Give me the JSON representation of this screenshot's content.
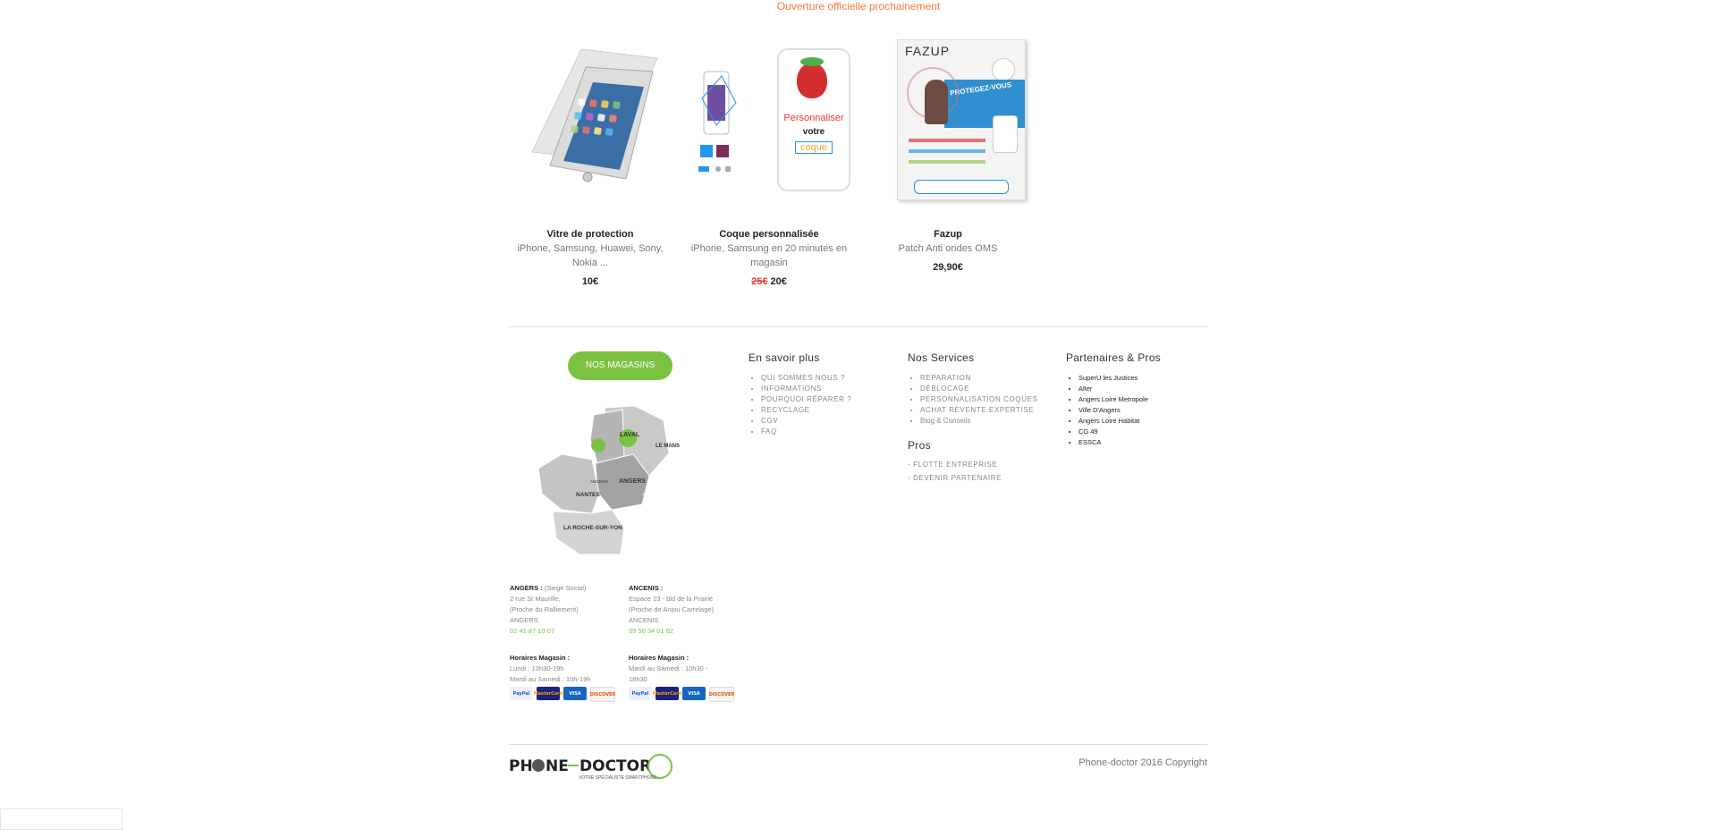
{
  "notice": "Ouverture officielle prochainement",
  "products": [
    {
      "name": "Vitre de protection",
      "desc": "iPhone, Samsung, Huawei, Sony, Nokia ...",
      "old_price": "",
      "price": "10€"
    },
    {
      "name": "Coque personnalisée",
      "desc": "iPhone, Samsung en 20 minutes en magasin",
      "old_price": "25€",
      "price": "20€",
      "image_text": {
        "line1": "Personnaliser",
        "line2": "votre",
        "line3": "coque"
      }
    },
    {
      "name": "Fazup",
      "desc": "Patch Anti ondes OMS",
      "old_price": "",
      "price": "29,90€",
      "image_text": {
        "brand": "FAZUP",
        "tagline": "PROTEGEZ-VOUS"
      }
    }
  ],
  "stores_button": "NOS MAGASINS",
  "map": {
    "laval": "LAVAL",
    "le_mans": "LE MANS",
    "ancenis": "ANCENIS",
    "angers": "ANGERS",
    "nantes": "NANTES",
    "la_roche": "LA ROCHE-SUR-YON",
    "saumur": "SAUMUR"
  },
  "stores": [
    {
      "city": "ANGERS :",
      "city_note": "(Siege Social)",
      "addr1": "2 rue St Maurille,",
      "addr2": "(Proche du Ralliement)",
      "addr3": "ANGERS",
      "phone": "02 41 87 10 07",
      "hours_title": "Horaires Magasin :",
      "hours1": "Lundi : 13h30-19h",
      "hours2": "Mardi au Samedi : 10h-19h"
    },
    {
      "city": "ANCENIS :",
      "city_note": "",
      "addr1": "Espace 23 - bld de la Prairie",
      "addr2": "(Proche de Anjou Carrelage)",
      "addr3": "ANCENIS",
      "phone": "09 50 34 01 62",
      "hours_title": "Horaires Magasin :",
      "hours1": "Mardi au Samedi : 10h30 -",
      "hours2": "18h30"
    }
  ],
  "cards": [
    "PayPal",
    "MasterCard",
    "VISA",
    "DISCOVER"
  ],
  "footer": {
    "col1": {
      "title": "En savoir plus",
      "items": [
        "QUI SOMMES NOUS ?",
        "INFORMATIONS",
        "POURQUOI RÉPARER ?",
        "RECYCLAGE",
        "CGV",
        "FAQ"
      ]
    },
    "col2": {
      "title": "Nos Services",
      "items": [
        "REPARATION",
        "DÉBLOCAGE",
        "PERSONNALISATION COQUES",
        "ACHAT REVENTE EXPERTISE",
        "Blog & Conseils"
      ]
    },
    "pros": {
      "title": "Pros",
      "items": [
        "- FLOTTE ENTREPRISE",
        "- DEVENIR PARTENAIRE"
      ]
    },
    "col3": {
      "title": "Partenaires & Pros",
      "items": [
        "SuperU les Justices",
        "Alter",
        "Angers Loire Metropole",
        "Ville D'Angers",
        "Angers Loire Habitat",
        "CG 49",
        "ESSCA"
      ]
    }
  },
  "logo": {
    "text_left": "PH",
    "text_right": "NE",
    "text_doctor": "DOCTOR",
    "tagline": "VOTRE SPÉCIALISTE SMARTPHONE"
  },
  "copyright": "Phone-doctor 2016 Copyright",
  "colors": {
    "accent": "#7cc242",
    "notice": "#f07a3e",
    "old_price": "#e53935"
  }
}
